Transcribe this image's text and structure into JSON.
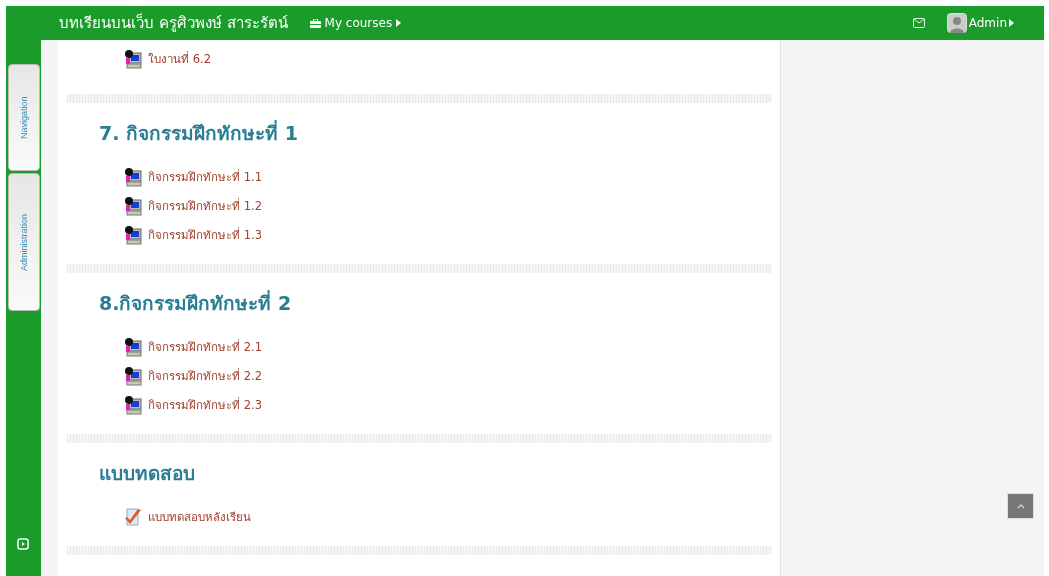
{
  "header": {
    "site_title": "บทเรียนบนเว็บ ครูศิวพงษ์ สาระรัตน์",
    "my_courses": "My courses",
    "user": "Admin"
  },
  "side_tabs": [
    "Navigation",
    "Administration"
  ],
  "sections": [
    {
      "items": [
        {
          "kind": "assignment",
          "label": "ใบงานที่ 6.2"
        }
      ]
    },
    {
      "heading": "7. กิจกรรมฝึกทักษะที่ 1",
      "items": [
        {
          "kind": "assignment",
          "label": "กิจกรรมฝึกทักษะที่ 1.1"
        },
        {
          "kind": "assignment",
          "label": "กิจกรรมฝึกทักษะที่ 1.2"
        },
        {
          "kind": "assignment",
          "label": "กิจกรรมฝึกทักษะที่ 1.3"
        }
      ]
    },
    {
      "heading": "8.กิจกรรมฝึกทักษะที่ 2",
      "items": [
        {
          "kind": "assignment",
          "label": "กิจกรรมฝึกทักษะที่ 2.1"
        },
        {
          "kind": "assignment",
          "label": "กิจกรรมฝึกทักษะที่ 2.2"
        },
        {
          "kind": "assignment",
          "label": "กิจกรรมฝึกทักษะที่ 2.3"
        }
      ]
    },
    {
      "heading": "แบบทดสอบ",
      "items": [
        {
          "kind": "quiz",
          "label": "แบบทดสอบหลังเรียน"
        }
      ]
    }
  ]
}
